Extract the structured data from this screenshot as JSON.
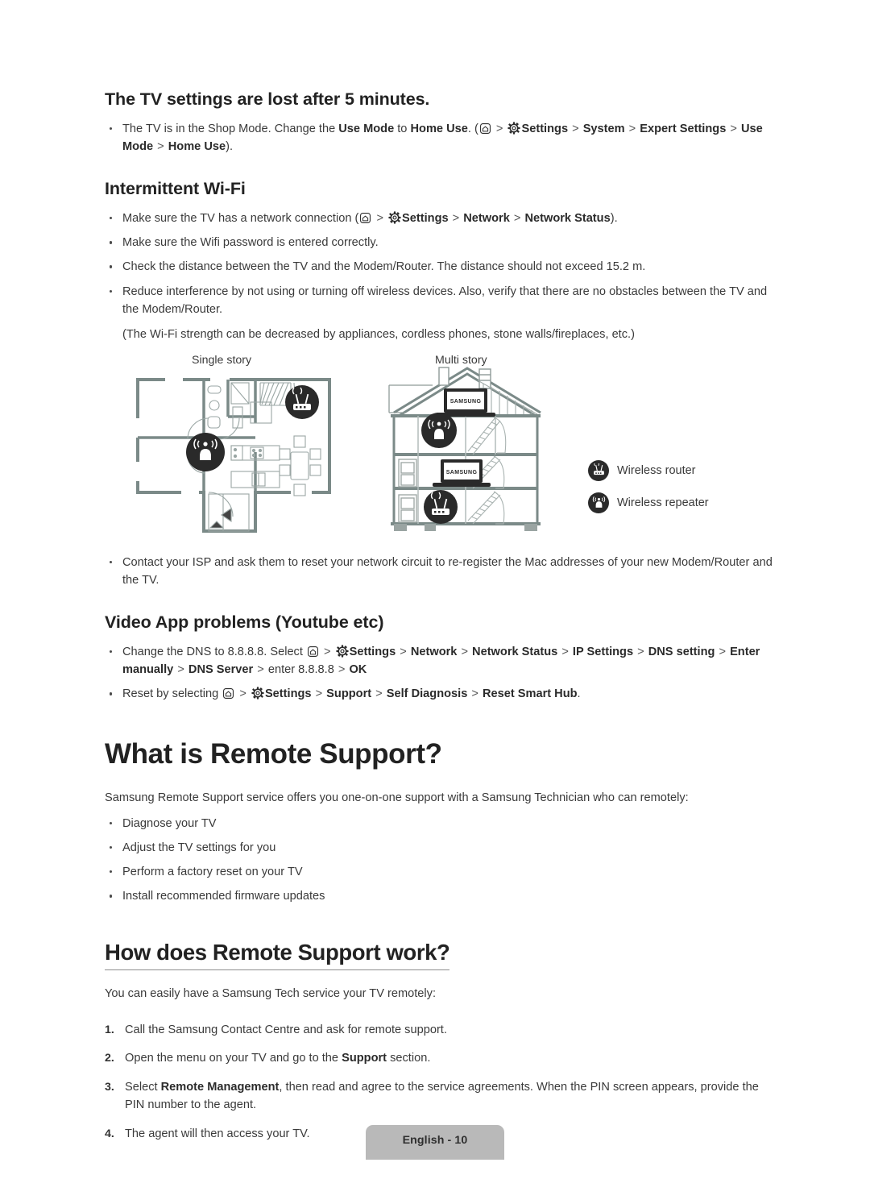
{
  "document": {
    "footer_label": "English - 10",
    "page_number": 10,
    "language": "English"
  },
  "sections": [
    {
      "id": "tv-settings-lost",
      "heading": "The TV settings are lost after 5 minutes.",
      "bullets": [
        {
          "parts": [
            {
              "t": "text",
              "v": "The TV is in the Shop Mode. Change the "
            },
            {
              "t": "bold",
              "v": "Use Mode"
            },
            {
              "t": "text",
              "v": " to "
            },
            {
              "t": "bold",
              "v": "Home Use"
            },
            {
              "t": "text",
              "v": ". ("
            },
            {
              "t": "icon",
              "v": "home-icon"
            },
            {
              "t": "sep",
              "v": ">"
            },
            {
              "t": "icon",
              "v": "gear-icon"
            },
            {
              "t": "bold",
              "v": "Settings"
            },
            {
              "t": "sep",
              "v": ">"
            },
            {
              "t": "bold",
              "v": "System"
            },
            {
              "t": "sep",
              "v": ">"
            },
            {
              "t": "bold",
              "v": "Expert Settings"
            },
            {
              "t": "sep",
              "v": ">"
            },
            {
              "t": "bold",
              "v": "Use Mode"
            },
            {
              "t": "sep",
              "v": ">"
            },
            {
              "t": "bold",
              "v": "Home Use"
            },
            {
              "t": "text",
              "v": ")."
            }
          ]
        }
      ]
    },
    {
      "id": "intermittent-wifi",
      "heading": "Intermittent Wi-Fi",
      "bullets": [
        {
          "parts": [
            {
              "t": "text",
              "v": "Make sure the TV has a network connection ("
            },
            {
              "t": "icon",
              "v": "home-icon"
            },
            {
              "t": "sep",
              "v": ">"
            },
            {
              "t": "icon",
              "v": "gear-icon"
            },
            {
              "t": "bold",
              "v": "Settings"
            },
            {
              "t": "sep",
              "v": ">"
            },
            {
              "t": "bold",
              "v": "Network"
            },
            {
              "t": "sep",
              "v": ">"
            },
            {
              "t": "bold",
              "v": "Network Status"
            },
            {
              "t": "text",
              "v": ")."
            }
          ]
        },
        {
          "parts": [
            {
              "t": "text",
              "v": "Make sure the Wifi password is entered correctly."
            }
          ]
        },
        {
          "parts": [
            {
              "t": "text",
              "v": "Check the distance between the TV and the Modem/Router. The distance should not exceed 15.2 m."
            }
          ]
        },
        {
          "parts": [
            {
              "t": "text",
              "v": "Reduce interference by not using or turning off wireless devices. Also, verify that there are no obstacles between the TV and the Modem/Router."
            }
          ]
        }
      ],
      "note": "(The Wi-Fi strength can be decreased by appliances, cordless phones, stone walls/fireplaces, etc.)",
      "diagram": {
        "caption_left": "Single story",
        "caption_right": "Multi story",
        "tv_brand": "SAMSUNG",
        "legend": [
          {
            "icon": "wireless-router-icon",
            "label": "Wireless router"
          },
          {
            "icon": "wireless-repeater-icon",
            "label": "Wireless repeater"
          }
        ],
        "wall_color": "#7b8a88",
        "badge_color": "#2a2a2a"
      },
      "bullets_after": [
        {
          "parts": [
            {
              "t": "text",
              "v": "Contact your ISP and ask them to reset your network circuit to re-register the Mac addresses of your new Modem/Router and the TV."
            }
          ]
        }
      ]
    },
    {
      "id": "video-app-problems",
      "heading": "Video App problems (Youtube etc)",
      "bullets": [
        {
          "parts": [
            {
              "t": "text",
              "v": "Change the DNS to 8.8.8.8. Select "
            },
            {
              "t": "icon",
              "v": "home-icon"
            },
            {
              "t": "sep",
              "v": ">"
            },
            {
              "t": "icon",
              "v": "gear-icon"
            },
            {
              "t": "bold",
              "v": "Settings"
            },
            {
              "t": "sep",
              "v": ">"
            },
            {
              "t": "bold",
              "v": "Network"
            },
            {
              "t": "sep",
              "v": ">"
            },
            {
              "t": "bold",
              "v": "Network Status"
            },
            {
              "t": "sep",
              "v": ">"
            },
            {
              "t": "bold",
              "v": "IP Settings"
            },
            {
              "t": "sep",
              "v": ">"
            },
            {
              "t": "bold",
              "v": "DNS setting"
            },
            {
              "t": "sep",
              "v": ">"
            },
            {
              "t": "bold",
              "v": "Enter manually"
            },
            {
              "t": "sep",
              "v": ">"
            },
            {
              "t": "bold",
              "v": "DNS Server"
            },
            {
              "t": "sep",
              "v": ">"
            },
            {
              "t": "text",
              "v": "enter 8.8.8.8 "
            },
            {
              "t": "sep",
              "v": ">"
            },
            {
              "t": "bold",
              "v": "OK"
            }
          ]
        },
        {
          "parts": [
            {
              "t": "text",
              "v": "Reset by selecting "
            },
            {
              "t": "icon",
              "v": "home-icon"
            },
            {
              "t": "sep",
              "v": ">"
            },
            {
              "t": "icon",
              "v": "gear-icon"
            },
            {
              "t": "bold",
              "v": "Settings"
            },
            {
              "t": "sep",
              "v": ">"
            },
            {
              "t": "bold",
              "v": "Support"
            },
            {
              "t": "sep",
              "v": ">"
            },
            {
              "t": "bold",
              "v": "Self Diagnosis"
            },
            {
              "t": "sep",
              "v": ">"
            },
            {
              "t": "bold",
              "v": "Reset Smart Hub"
            },
            {
              "t": "text",
              "v": "."
            }
          ]
        }
      ]
    },
    {
      "id": "what-is-remote-support",
      "heading": "What is Remote Support?",
      "intro": "Samsung Remote Support service offers you one-on-one support with a Samsung Technician who can remotely:",
      "bullets": [
        {
          "parts": [
            {
              "t": "text",
              "v": "Diagnose your TV"
            }
          ]
        },
        {
          "parts": [
            {
              "t": "text",
              "v": "Adjust the TV settings for you"
            }
          ]
        },
        {
          "parts": [
            {
              "t": "text",
              "v": "Perform a factory reset on your TV"
            }
          ]
        },
        {
          "parts": [
            {
              "t": "text",
              "v": "Install recommended firmware updates"
            }
          ]
        }
      ]
    },
    {
      "id": "how-does-remote-support-work",
      "heading": "How does Remote Support work?",
      "intro": "You can easily have a Samsung Tech service your TV remotely:",
      "steps": [
        {
          "marker": "1.",
          "parts": [
            {
              "t": "text",
              "v": "Call the Samsung Contact Centre and ask for remote support."
            }
          ]
        },
        {
          "marker": "2.",
          "parts": [
            {
              "t": "text",
              "v": "Open the menu on your TV and go to the "
            },
            {
              "t": "bold",
              "v": "Support"
            },
            {
              "t": "text",
              "v": " section."
            }
          ]
        },
        {
          "marker": "3.",
          "parts": [
            {
              "t": "text",
              "v": "Select "
            },
            {
              "t": "bold",
              "v": "Remote Management"
            },
            {
              "t": "text",
              "v": ", then read and agree to the service agreements. When the PIN screen appears, provide the PIN number to the agent."
            }
          ]
        },
        {
          "marker": "4.",
          "parts": [
            {
              "t": "text",
              "v": "The agent will then access your TV."
            }
          ]
        }
      ]
    }
  ]
}
